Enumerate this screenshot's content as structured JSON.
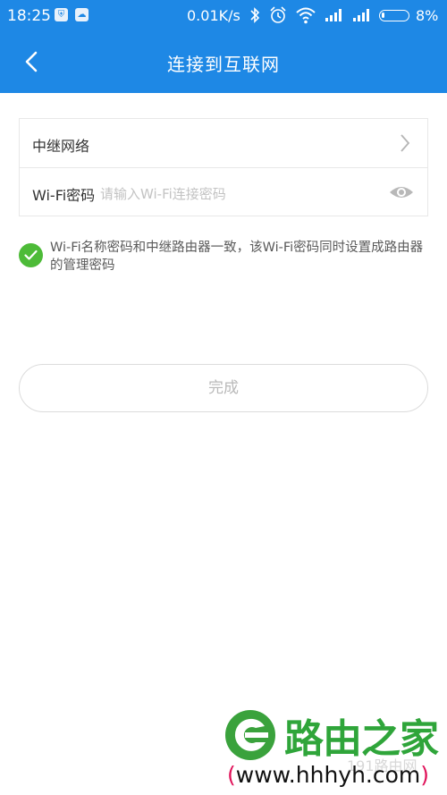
{
  "status_bar": {
    "time": "18:25",
    "network_speed": "0.01K/s",
    "battery_percent": "8%",
    "icons": [
      "shield-app-icon",
      "cloud-app-icon",
      "bluetooth-icon",
      "alarm-icon",
      "wifi-icon",
      "signal-icon",
      "signal-icon",
      "battery-icon"
    ]
  },
  "header": {
    "title": "连接到互联网",
    "back_icon": "back-arrow-icon",
    "background": "#1e88e5"
  },
  "form": {
    "relay_network_label": "中继网络",
    "relay_network_icon": "chevron-right-icon",
    "wifi_password_label": "Wi-Fi密码",
    "wifi_password_placeholder": "请输入Wi-Fi连接密码",
    "password_visibility_icon": "eye-icon"
  },
  "option": {
    "checked": true,
    "check_icon": "checkmark-icon",
    "text": "Wi-Fi名称密码和中继路由器一致，该Wi-Fi密码同时设置成路由器的管理密码",
    "accent": "#4dbb38"
  },
  "done_button": {
    "label": "完成"
  },
  "watermark": {
    "brand": "路由之家",
    "url_open": "(",
    "url": "www.hhhyh.com",
    "url_close": ")",
    "faint_text": "191路由网"
  }
}
